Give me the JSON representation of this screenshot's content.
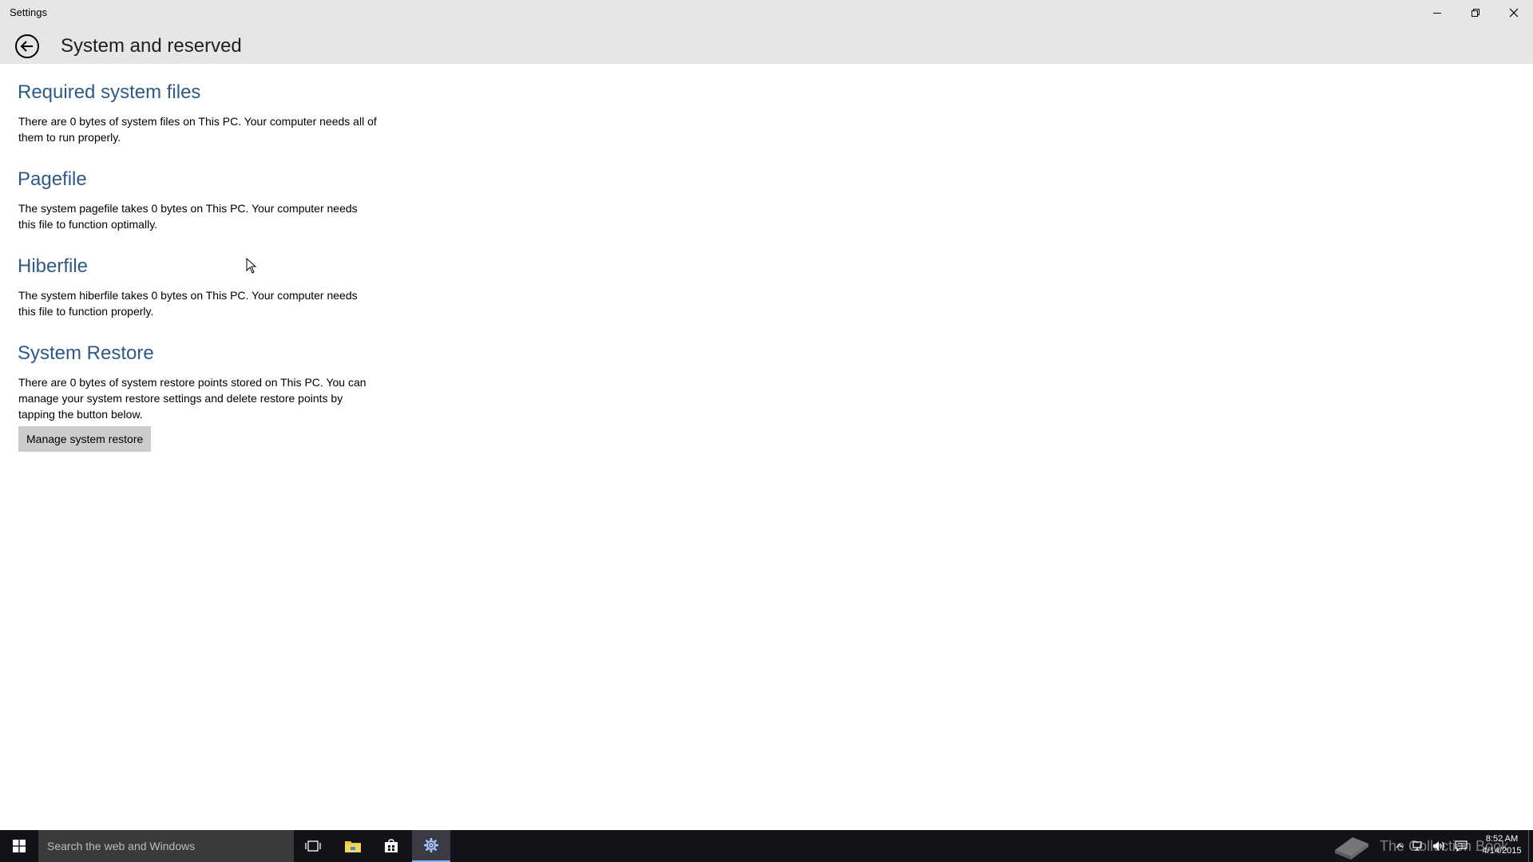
{
  "window": {
    "app_title": "Settings",
    "page_title": "System and reserved"
  },
  "sections": [
    {
      "heading": "Required system files",
      "text": "There are 0 bytes of system files on This PC. Your computer needs all of them to run properly."
    },
    {
      "heading": "Pagefile",
      "text": "The system pagefile takes 0 bytes on This PC. Your computer needs this file to function optimally."
    },
    {
      "heading": "Hiberfile",
      "text": "The system hiberfile takes 0 bytes on This PC. Your computer needs this file to function properly."
    },
    {
      "heading": "System Restore",
      "text": "There are 0 bytes of system restore points stored on This PC. You can manage your system restore settings and delete restore points by tapping the button below.",
      "button_label": "Manage system restore"
    }
  ],
  "taskbar": {
    "search_placeholder": "Search the web and Windows",
    "watermark_text": "The Collection Book",
    "clock_time": "8:52 AM",
    "clock_date": "4/14/2015"
  },
  "colors": {
    "heading": "#2e5a87",
    "titlebar": "#e6e6e6",
    "taskbar": "#121318",
    "button": "#cccccc"
  },
  "icons": {
    "back": "back-arrow-icon",
    "minimize": "minimize-icon",
    "restore": "restore-icon",
    "close": "close-icon",
    "start": "windows-logo-icon",
    "task_view": "task-view-icon",
    "file_explorer": "folder-icon",
    "store": "store-icon",
    "settings": "gear-icon"
  }
}
